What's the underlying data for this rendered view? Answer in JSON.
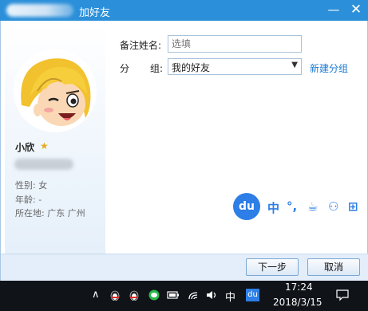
{
  "titlebar": {
    "title": "加好友",
    "minimize_icon": "minimize-icon",
    "close_icon": "close-icon"
  },
  "profile": {
    "nickname": "小欣",
    "star": "★",
    "gender": "性别: 女",
    "age": "年龄:  -",
    "location": "所在地: 广东  广州"
  },
  "form": {
    "remark_label": "备注姓名:",
    "remark_placeholder": "选填",
    "group_label_left": "分",
    "group_label_right": "组:",
    "group_value": "我的好友",
    "dropdown_arrow": "▼",
    "new_group_link": "新建分组"
  },
  "ime": {
    "logo": "du",
    "mode": "中",
    "punct": "°,",
    "cup": "☕",
    "user": "⚇",
    "grid": "⊞"
  },
  "buttons": {
    "next": "下一步",
    "cancel": "取消"
  },
  "taskbar": {
    "chevron": "∧",
    "ime_mode": "中",
    "du_badge": "du",
    "time": "17:24",
    "date": "2018/3/15",
    "notification_icon": "▭"
  },
  "colors": {
    "titlebar": "#2b8fd9",
    "accent": "#1a7ad4",
    "taskbar": "#101318"
  }
}
